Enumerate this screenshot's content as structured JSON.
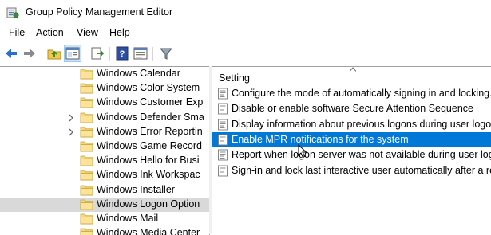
{
  "window": {
    "title": "Group Policy Management Editor"
  },
  "menu": {
    "file": "File",
    "action": "Action",
    "view": "View",
    "help": "Help"
  },
  "toolbar": {
    "icons": [
      "back-arrow-icon",
      "forward-arrow-icon",
      "up-folder-icon",
      "show-hide-tree-icon",
      "export-list-icon",
      "help-icon",
      "properties-pane-icon",
      "filter-icon"
    ]
  },
  "tree": {
    "items": [
      {
        "label": "Windows Calendar",
        "expandable": false,
        "selected": false
      },
      {
        "label": "Windows Color System",
        "expandable": false,
        "selected": false
      },
      {
        "label": "Windows Customer Exp",
        "expandable": false,
        "selected": false
      },
      {
        "label": "Windows Defender Sma",
        "expandable": true,
        "selected": false
      },
      {
        "label": "Windows Error Reportin",
        "expandable": true,
        "selected": false
      },
      {
        "label": "Windows Game Record",
        "expandable": false,
        "selected": false
      },
      {
        "label": "Windows Hello for Busi",
        "expandable": false,
        "selected": false
      },
      {
        "label": "Windows Ink Workspac",
        "expandable": false,
        "selected": false
      },
      {
        "label": "Windows Installer",
        "expandable": false,
        "selected": false
      },
      {
        "label": "Windows Logon Option",
        "expandable": false,
        "selected": true
      },
      {
        "label": "Windows Mail",
        "expandable": false,
        "selected": false
      },
      {
        "label": "Windows Media Center",
        "expandable": false,
        "selected": false
      }
    ]
  },
  "list": {
    "column_header": "Setting",
    "rows": [
      {
        "label": "Configure the mode of automatically signing in and locking...",
        "selected": false
      },
      {
        "label": "Disable or enable software Secure Attention Sequence",
        "selected": false
      },
      {
        "label": "Display information about previous logons during user logon",
        "selected": false
      },
      {
        "label": "Enable MPR notifications for the system",
        "selected": true
      },
      {
        "label": "Report when logon server was not available during user logon",
        "selected": false
      },
      {
        "label": "Sign-in and lock last interactive user automatically after a re...",
        "selected": false
      }
    ]
  },
  "colors": {
    "selection_blue": "#0078d7",
    "tree_selection_gray": "#d9d9d9",
    "folder_yellow": "#f8d775"
  }
}
